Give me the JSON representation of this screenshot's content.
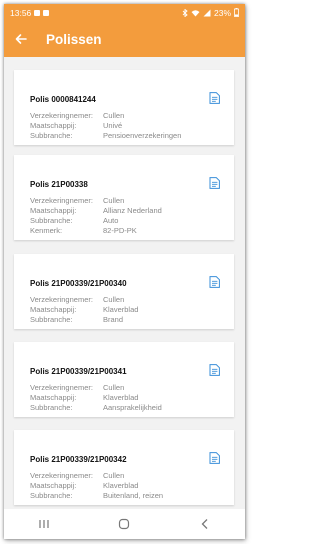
{
  "status": {
    "time": "13:56",
    "battery": "23%"
  },
  "appbar": {
    "title": "Polissen"
  },
  "colors": {
    "accent": "#f39c3d",
    "doc_icon": "#3a8fd9"
  },
  "policies": [
    {
      "title": "Polis 0000841244",
      "fields": [
        {
          "label": "Verzekeringnemer:",
          "value": "Cullen"
        },
        {
          "label": "Maatschappij:",
          "value": "Univé"
        },
        {
          "label": "Subbranche:",
          "value": "Pensioenverzekeringen"
        }
      ]
    },
    {
      "title": "Polis 21P00338",
      "fields": [
        {
          "label": "Verzekeringnemer:",
          "value": "Cullen"
        },
        {
          "label": "Maatschappij:",
          "value": "Allianz Nederland"
        },
        {
          "label": "Subbranche:",
          "value": "Auto"
        },
        {
          "label": "Kenmerk:",
          "value": "82-PD-PK"
        }
      ]
    },
    {
      "title": "Polis 21P00339/21P00340",
      "fields": [
        {
          "label": "Verzekeringnemer:",
          "value": "Cullen"
        },
        {
          "label": "Maatschappij:",
          "value": "Klaverblad"
        },
        {
          "label": "Subbranche:",
          "value": "Brand"
        }
      ]
    },
    {
      "title": "Polis 21P00339/21P00341",
      "fields": [
        {
          "label": "Verzekeringnemer:",
          "value": "Cullen"
        },
        {
          "label": "Maatschappij:",
          "value": "Klaverblad"
        },
        {
          "label": "Subbranche:",
          "value": "Aansprakelijkheid"
        }
      ]
    },
    {
      "title": "Polis 21P00339/21P00342",
      "fields": [
        {
          "label": "Verzekeringnemer:",
          "value": "Cullen"
        },
        {
          "label": "Maatschappij:",
          "value": "Klaverblad"
        },
        {
          "label": "Subbranche:",
          "value": "Buitenland, reizen"
        }
      ]
    }
  ],
  "icons": {
    "back": "arrow-left-icon",
    "document": "document-icon",
    "nav": [
      "recent-apps-icon",
      "home-icon",
      "back-nav-icon"
    ]
  }
}
